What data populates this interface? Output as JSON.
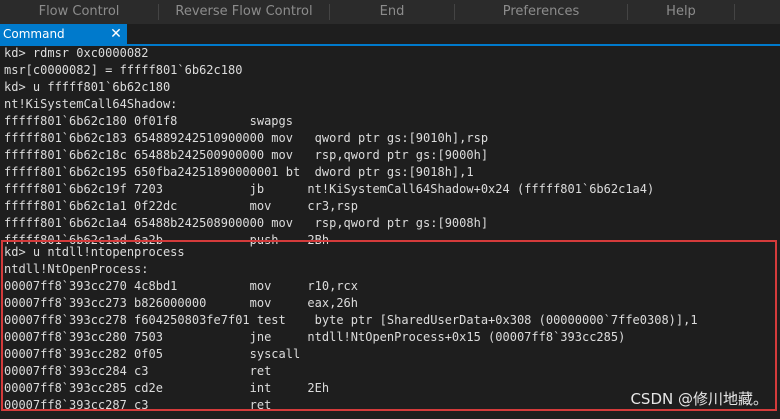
{
  "menu": {
    "items": [
      "Flow Control",
      "Reverse Flow Control",
      "End",
      "Preferences",
      "Help"
    ]
  },
  "tab": {
    "label": "Command",
    "close_glyph": "✕"
  },
  "console": {
    "lines": [
      "kd> rdmsr 0xc0000082",
      "msr[c0000082] = fffff801`6b62c180",
      "kd> u fffff801`6b62c180",
      "nt!KiSystemCall64Shadow:",
      "fffff801`6b62c180 0f01f8          swapgs",
      "fffff801`6b62c183 654889242510900000 mov   qword ptr gs:[9010h],rsp",
      "fffff801`6b62c18c 65488b242500900000 mov   rsp,qword ptr gs:[9000h]",
      "fffff801`6b62c195 650fba24251890000001 bt  dword ptr gs:[9018h],1",
      "fffff801`6b62c19f 7203            jb      nt!KiSystemCall64Shadow+0x24 (fffff801`6b62c1a4)",
      "fffff801`6b62c1a1 0f22dc          mov     cr3,rsp",
      "fffff801`6b62c1a4 65488b242508900000 mov   rsp,qword ptr gs:[9008h]",
      "fffff801`6b62c1ad 6a2b            push    2Bh",
      "kd> u ntdll!ntopenprocess",
      "ntdll!NtOpenProcess:",
      "00007ff8`393cc270 4c8bd1          mov     r10,rcx",
      "00007ff8`393cc273 b826000000      mov     eax,26h",
      "00007ff8`393cc278 f604250803fe7f01 test    byte ptr [SharedUserData+0x308 (00000000`7ffe0308)],1",
      "00007ff8`393cc280 7503            jne     ntdll!NtOpenProcess+0x15 (00007ff8`393cc285)",
      "00007ff8`393cc282 0f05            syscall",
      "00007ff8`393cc284 c3              ret",
      "00007ff8`393cc285 cd2e            int     2Eh",
      "00007ff8`393cc287 c3              ret"
    ]
  },
  "watermark": {
    "text": "CSDN @修川地藏。"
  },
  "colors": {
    "background": "#1e1e1e",
    "accent": "#007acc",
    "highlight_border": "#d43b3b",
    "text": "#dcdcdc"
  }
}
